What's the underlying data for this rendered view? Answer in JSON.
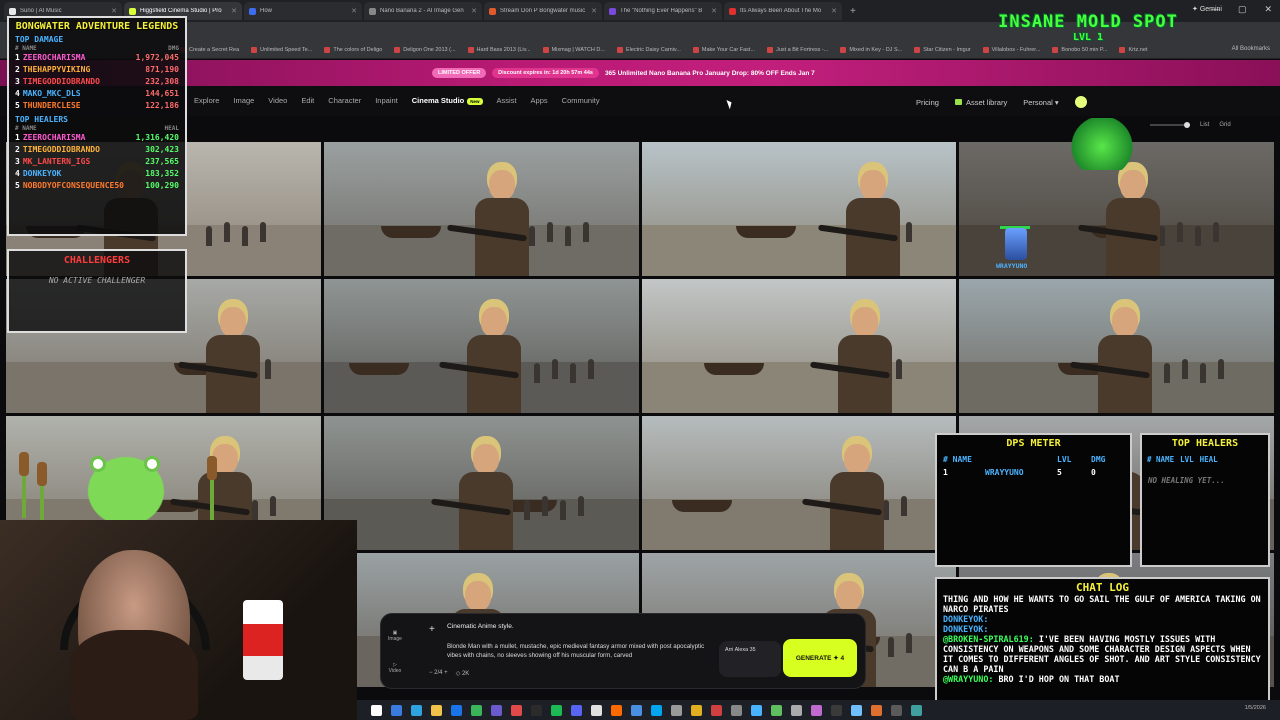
{
  "browser": {
    "tabs": [
      {
        "label": "Suno | AI Music",
        "color": "#e8e8e8"
      },
      {
        "label": "Higgsfield Cinema Studio | Pro",
        "color": "#d7ff3a",
        "active": true
      },
      {
        "label": "How",
        "color": "#3f6df0"
      },
      {
        "label": "Nano Banana 2 - AI Image Gen",
        "color": "#888888"
      },
      {
        "label": "Stream Don P Bongwater music",
        "color": "#e05a2b"
      },
      {
        "label": "The \"Nothing Ever Happens\" B",
        "color": "#7a4ae0"
      },
      {
        "label": "Its Always Been About The Mo",
        "color": "#e03030"
      }
    ],
    "new_tab": "+",
    "gemini": "Gemini",
    "bookmarks": [
      "Create a Secret Rea",
      "Unlimited Speed Te...",
      "The colors of Deligo",
      "Deligon One 2013 (...",
      "Hard Bass 2013 (Liv...",
      "Mixmag | WATCH D...",
      "Electric Daisy Carniv...",
      "Make Your Car Fast...",
      "Just a Bit Fortress -...",
      "Mixed in Key - DJ S...",
      "Star Citizen - Imgur",
      "Villalobos - Fuhrer...",
      "Bonobo 50 min P...",
      "Krtz.net"
    ],
    "all_bookmarks": "All Bookmarks"
  },
  "promo": {
    "badge": "LIMITED OFFER",
    "discount": "Discount expires in: 1d 20h 57m 44s",
    "text": "365 Unlimited Nano Banana Pro January Drop: 80% OFF Ends Jan 7"
  },
  "nav": {
    "links": [
      "Explore",
      "Image",
      "Video",
      "Edit",
      "Character",
      "Inpaint",
      "Cinema Studio",
      "Assist",
      "Apps",
      "Community"
    ],
    "active": "Cinema Studio",
    "new_tag": "New",
    "pricing": "Pricing",
    "asset_library": "Asset library",
    "workspace": "Personal",
    "view_list": "List",
    "view_grid": "Grid"
  },
  "overlay_legends": {
    "title": "BONGWATER ADVENTURE LEGENDS",
    "damage_title": "TOP DAMAGE",
    "damage_hdr_name": "# NAME",
    "damage_hdr_val": "DMG",
    "damage": [
      {
        "rank": "1",
        "name": "ZEEROCHARISMA",
        "value": "1,972,045"
      },
      {
        "rank": "2",
        "name": "THEHAPPYVIKING",
        "value": "871,190"
      },
      {
        "rank": "3",
        "name": "TIMEGODDIOBRANDO",
        "value": "232,308"
      },
      {
        "rank": "4",
        "name": "MAKO_MKC_DLS",
        "value": "144,651"
      },
      {
        "rank": "5",
        "name": "THUNDERCLESE",
        "value": "122,186"
      }
    ],
    "heal_title": "TOP HEALERS",
    "heal_hdr_name": "# NAME",
    "heal_hdr_val": "HEAL",
    "heal": [
      {
        "rank": "1",
        "name": "ZEEROCHARISMA",
        "value": "1,316,420"
      },
      {
        "rank": "2",
        "name": "TIMEGODDIOBRANDO",
        "value": "302,423"
      },
      {
        "rank": "3",
        "name": "MK_LANTERN_IGS",
        "value": "237,565"
      },
      {
        "rank": "4",
        "name": "DONKEYOK",
        "value": "183,352"
      },
      {
        "rank": "5",
        "name": "NOBODYOFCONSEQUENCE50",
        "value": "100,290"
      }
    ]
  },
  "challengers": {
    "title": "CHALLENGERS",
    "empty": "NO ACTIVE CHALLENGER"
  },
  "mold": {
    "title": "INSANE MOLD SPOT",
    "level": "LVL 1"
  },
  "player_tag": "WRAYYUNO",
  "dps_meter": {
    "title": "DPS METER",
    "headers": [
      "# NAME",
      "",
      "LVL",
      "DMG"
    ],
    "rows": [
      {
        "rank": "1",
        "name": "WRAYYUNO",
        "lvl": "5",
        "dmg": "0"
      }
    ]
  },
  "top_healers_small": {
    "title": "TOP HEALERS",
    "headers": [
      "# NAME",
      "LVL",
      "HEAL"
    ],
    "empty": "NO HEALING YET..."
  },
  "chat": {
    "title": "CHAT LOG",
    "messages": [
      {
        "user": "",
        "text": "THING AND HOW HE WANTS TO GO SAIL THE GULF OF AMERICA TAKING ON NARCO PIRATES"
      },
      {
        "user": "DONKEYOK:",
        "text": ""
      },
      {
        "user": "DONKEYOK:",
        "text": ""
      },
      {
        "user": "@BROKEN-SPIRAL619:",
        "text": "I'VE BEEN HAVING MOSTLY ISSUES WITH CONSISTENCY ON WEAPONS AND SOME CHARACTER DESIGN ASPECTS WHEN IT COMES TO DIFFERENT ANGLES OF SHOT. AND ART STYLE CONSISTENCY CAN B A PAIN"
      },
      {
        "user": "@WRAYYUNO:",
        "text": "BRO I'D HOP ON THAT BOAT"
      }
    ]
  },
  "prompt": {
    "mode_image": "Image",
    "mode_video": "Video",
    "plus": "+",
    "line1": "Cinematic Anime style.",
    "line2": "Blonde Man with a mullet, mustache, epic medieval fantasy armor mixed with post apocalyptic vibes with chains, no sleeves showing off his muscular form, carved",
    "count": "2/4",
    "resolution": "2K",
    "model": "Arri Alexa 35",
    "generate": "GENERATE ✦ 4"
  },
  "clock": "1/5/2026"
}
